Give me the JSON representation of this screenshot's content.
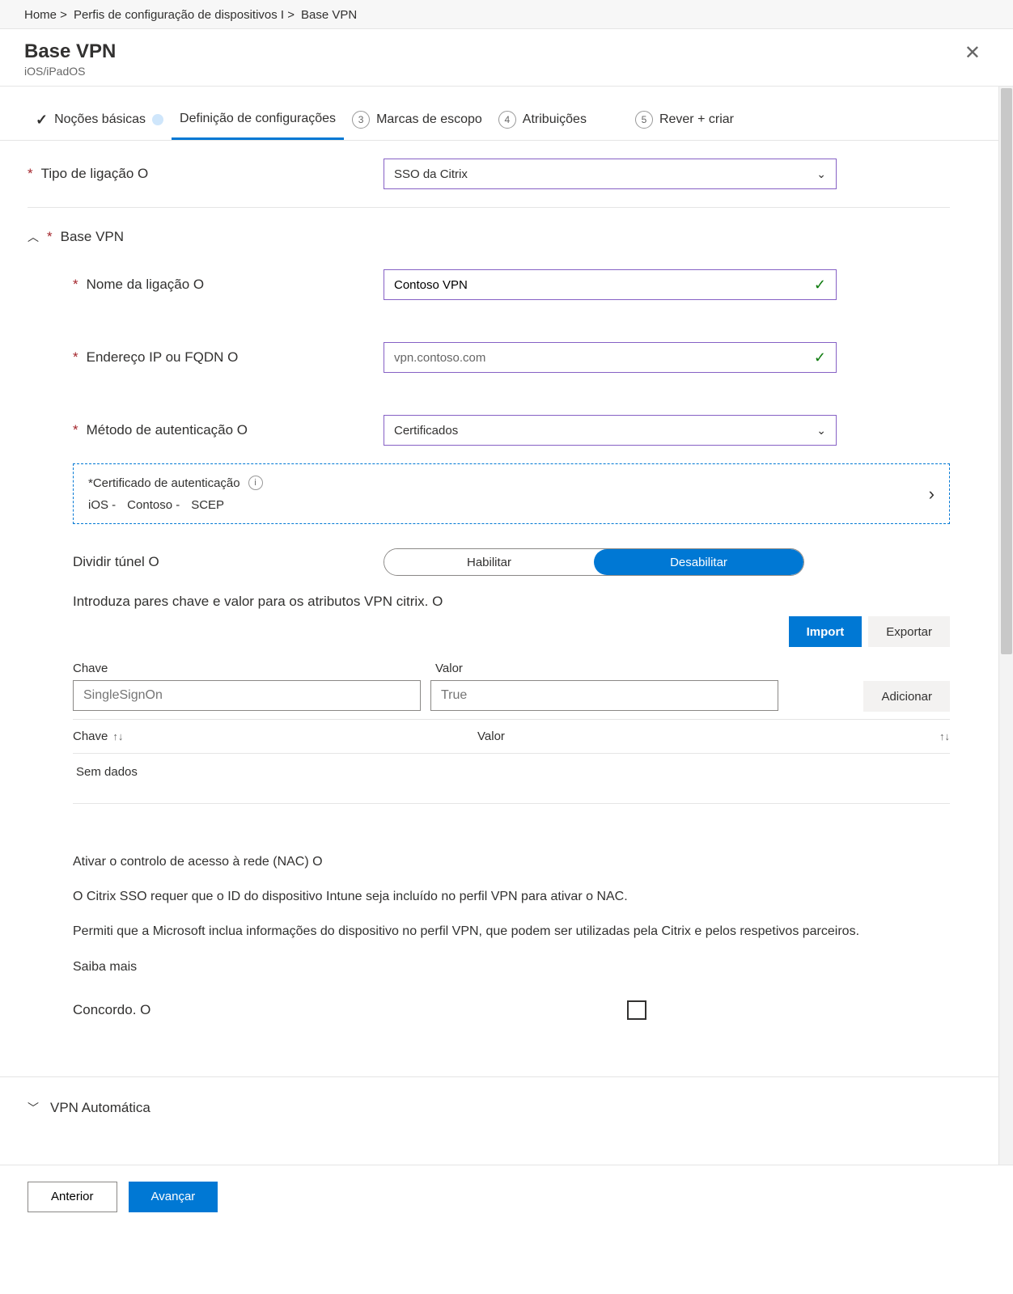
{
  "breadcrumb": [
    "Home >",
    "Perfis de configuração de dispositivos I >",
    "Base VPN"
  ],
  "header": {
    "title": "Base VPN",
    "subtitle": "iOS/iPadOS"
  },
  "tabs": {
    "basics": {
      "label": "Noções básicas",
      "done": true
    },
    "config": {
      "label": "Definição de configurações"
    },
    "scope": {
      "number": "3",
      "label": "Marcas de escopo"
    },
    "assign": {
      "number": "4",
      "label": "Atribuições"
    },
    "review": {
      "number": "5",
      "label": "Rever + criar"
    }
  },
  "fields": {
    "connection_type": {
      "label": "Tipo de ligação O",
      "value": "SSO da Citrix"
    },
    "section_base": {
      "label": "Base VPN"
    },
    "conn_name": {
      "label": "Nome da ligação O",
      "value": "Contoso VPN"
    },
    "address": {
      "label": "Endereço IP ou FQDN O",
      "value": "vpn.contoso.com"
    },
    "auth_method": {
      "label": "Método de autenticação O",
      "value": "Certificados"
    },
    "auth_cert": {
      "label": "*Certificado de autenticação",
      "value_parts": [
        "iOS -",
        "Contoso -",
        "SCEP"
      ]
    },
    "split_tunnel": {
      "label": "Dividir túnel O",
      "enable": "Habilitar",
      "disable": "Desabilitar"
    },
    "kv_intro": "Introduza pares chave e valor para os atributos VPN citrix. O",
    "kv_import": "Import",
    "kv_export": "Exportar",
    "kv_add": "Adicionar",
    "kv_key_label": "Chave",
    "kv_value_label": "Valor",
    "kv_key_ph": "SingleSignOn",
    "kv_value_ph": "True",
    "kv_th_key": "Chave",
    "kv_th_value": "Valor",
    "kv_empty": "Sem dados",
    "nac_title": "Ativar o controlo de acesso à rede (NAC) O",
    "nac_line1": "O Citrix SSO requer que o ID do dispositivo Intune seja incluído no perfil VPN para ativar o NAC.",
    "nac_line2": "Permiti que a Microsoft inclua informações do dispositivo no perfil VPN, que podem ser utilizadas pela Citrix e pelos respetivos parceiros.",
    "nac_learn": "Saiba mais",
    "agree_label": "Concordo. O",
    "auto_vpn": "VPN Automática"
  },
  "footer": {
    "prev": "Anterior",
    "next": "Avançar"
  }
}
